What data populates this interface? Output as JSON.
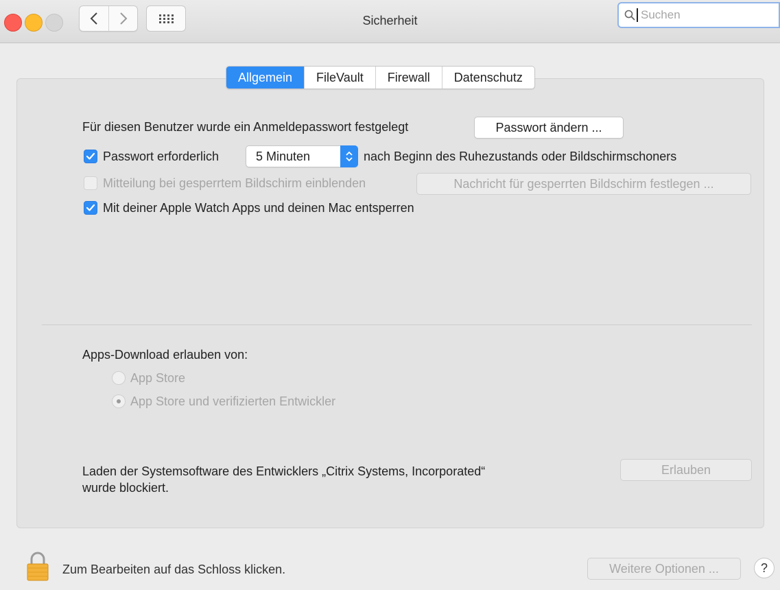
{
  "window": {
    "title": "Sicherheit"
  },
  "search": {
    "placeholder": "Suchen"
  },
  "tabs": [
    {
      "label": "Allgemein",
      "active": true
    },
    {
      "label": "FileVault",
      "active": false
    },
    {
      "label": "Firewall",
      "active": false
    },
    {
      "label": "Datenschutz",
      "active": false
    }
  ],
  "general": {
    "login_password_text": "Für diesen Benutzer wurde ein Anmeldepasswort festgelegt",
    "change_password_button": "Passwort ändern ...",
    "require_password": {
      "label": "Passwort erforderlich",
      "checked": true
    },
    "require_password_delay": "5 Minuten",
    "require_password_suffix": "nach Beginn des Ruhezustands oder Bildschirmschoners",
    "lock_message": {
      "label": "Mitteilung bei gesperrtem Bildschirm einblenden",
      "checked": false,
      "enabled": false
    },
    "lock_message_button": "Nachricht für gesperrten Bildschirm festlegen ...",
    "apple_watch": {
      "label": "Mit deiner Apple Watch Apps und deinen Mac entsperren",
      "checked": true
    }
  },
  "downloads": {
    "heading": "Apps-Download erlauben von:",
    "options": [
      {
        "label": "App Store",
        "selected": false
      },
      {
        "label": "App Store und verifizierten Entwickler",
        "selected": true
      }
    ]
  },
  "blocked": {
    "text_line1": "Laden der Systemsoftware des Entwicklers „Citrix Systems, Incorporated“",
    "text_line2": "wurde blockiert.",
    "allow_button": "Erlauben"
  },
  "footer": {
    "lock_text": "Zum Bearbeiten auf das Schloss klicken.",
    "more_options_button": "Weitere Optionen ...",
    "help_label": "?"
  },
  "colors": {
    "accent": "#2e8cf5",
    "disabled_text": "#a6a6a6"
  }
}
